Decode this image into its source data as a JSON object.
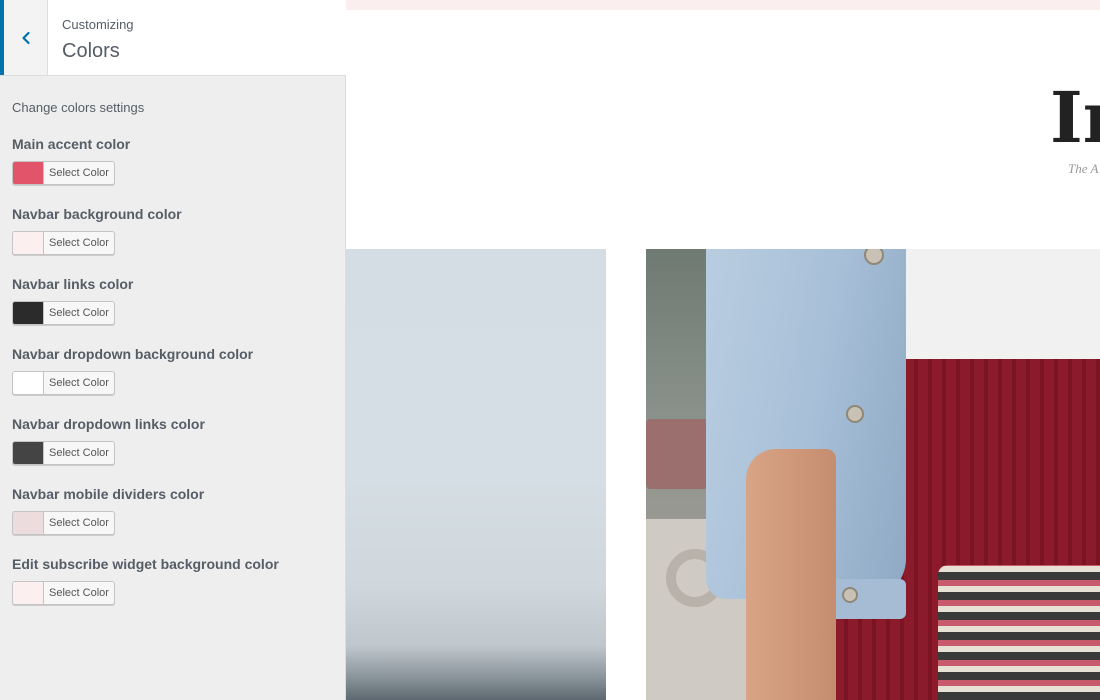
{
  "header": {
    "breadcrumb": "Customizing",
    "title": "Colors"
  },
  "section": {
    "description": "Change colors settings"
  },
  "controls": [
    {
      "label": "Main accent color",
      "button_label": "Select Color",
      "color": "#e2546a"
    },
    {
      "label": "Navbar background color",
      "button_label": "Select Color",
      "color": "#fbeff0"
    },
    {
      "label": "Navbar links color",
      "button_label": "Select Color",
      "color": "#2b2b2b"
    },
    {
      "label": "Navbar dropdown background color",
      "button_label": "Select Color",
      "color": "#ffffff"
    },
    {
      "label": "Navbar dropdown links color",
      "button_label": "Select Color",
      "color": "#444444"
    },
    {
      "label": "Navbar mobile dividers color",
      "button_label": "Select Color",
      "color": "#ecdcdd"
    },
    {
      "label": "Edit subscribe widget background color",
      "button_label": "Select Color",
      "color": "#fbeff0"
    }
  ],
  "preview": {
    "logo_text": "In",
    "tagline": "The A",
    "navbar_color": "#fbeeee"
  },
  "icons": {
    "back": "chevron-left-icon"
  },
  "colors": {
    "accent": "#0073aa"
  }
}
